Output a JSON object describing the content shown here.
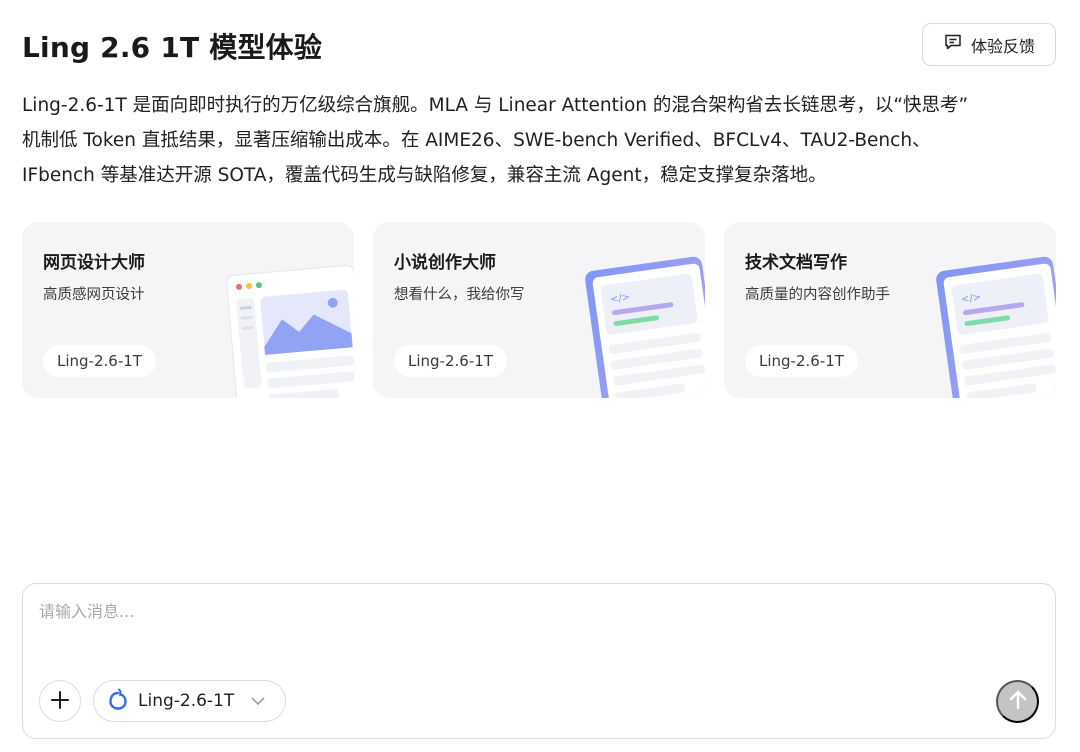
{
  "header": {
    "title": "Ling 2.6 1T 模型体验",
    "feedback_label": "体验反馈"
  },
  "description": {
    "lines": [
      "Ling-2.6-1T 是面向即时执行的万亿级综合旗舰。MLA 与 Linear Attention 的混合架构省去长链思考，以“快思考”",
      "机制低 Token 直抵结果，显著压缩输出成本。在 AIME26、SWE-bench Verified、BFCLv4、TAU2-Bench、",
      "IFbench 等基准达开源 SOTA，覆盖代码生成与缺陷修复，兼容主流 Agent，稳定支撑复杂落地。"
    ]
  },
  "cards": [
    {
      "title": "网页设计大师",
      "subtitle": "高质感网页设计",
      "tag": "Ling-2.6-1T",
      "icon": "webpage-illustration"
    },
    {
      "title": "小说创作大师",
      "subtitle": "想看什么，我给你写",
      "tag": "Ling-2.6-1T",
      "icon": "code-doc-illustration"
    },
    {
      "title": "技术文档写作",
      "subtitle": "高质量的内容创作助手",
      "tag": "Ling-2.6-1T",
      "icon": "code-doc-illustration"
    }
  ],
  "composer": {
    "placeholder": "请输入消息...",
    "value": "",
    "model_label": "Ling-2.6-1T",
    "add_icon": "plus-icon",
    "send_icon": "arrow-up-icon"
  },
  "colors": {
    "card_bg": "#f5f5f7",
    "accent_blue": "#8ea0f5",
    "accent_green": "#7fdca6",
    "accent_purple": "#b7a6f0",
    "send_disabled": "#c4c4c4",
    "brand_logo": "#2f6df6"
  }
}
